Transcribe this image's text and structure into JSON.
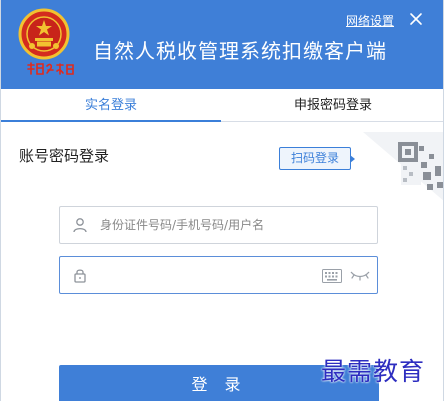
{
  "header": {
    "title": "自然人税收管理系统扣缴客户端",
    "network_settings": "网络设置",
    "logo_text": "中国税务",
    "close_icon": "close-icon",
    "emblem_icon": "national-emblem-icon"
  },
  "tabs": [
    {
      "label": "实名登录",
      "active": true
    },
    {
      "label": "申报密码登录",
      "active": false
    }
  ],
  "login": {
    "section_title": "账号密码登录",
    "scan_button": "扫码登录",
    "username_placeholder": "身份证件号码/手机号码/用户名",
    "username_value": "",
    "password_value": "",
    "password_placeholder": "",
    "login_button": "登 录"
  },
  "watermark": "最需教育",
  "colors": {
    "accent": "#3f7fd7",
    "tab_active": "#3b7fd9",
    "watermark": "#2d2dc0"
  }
}
